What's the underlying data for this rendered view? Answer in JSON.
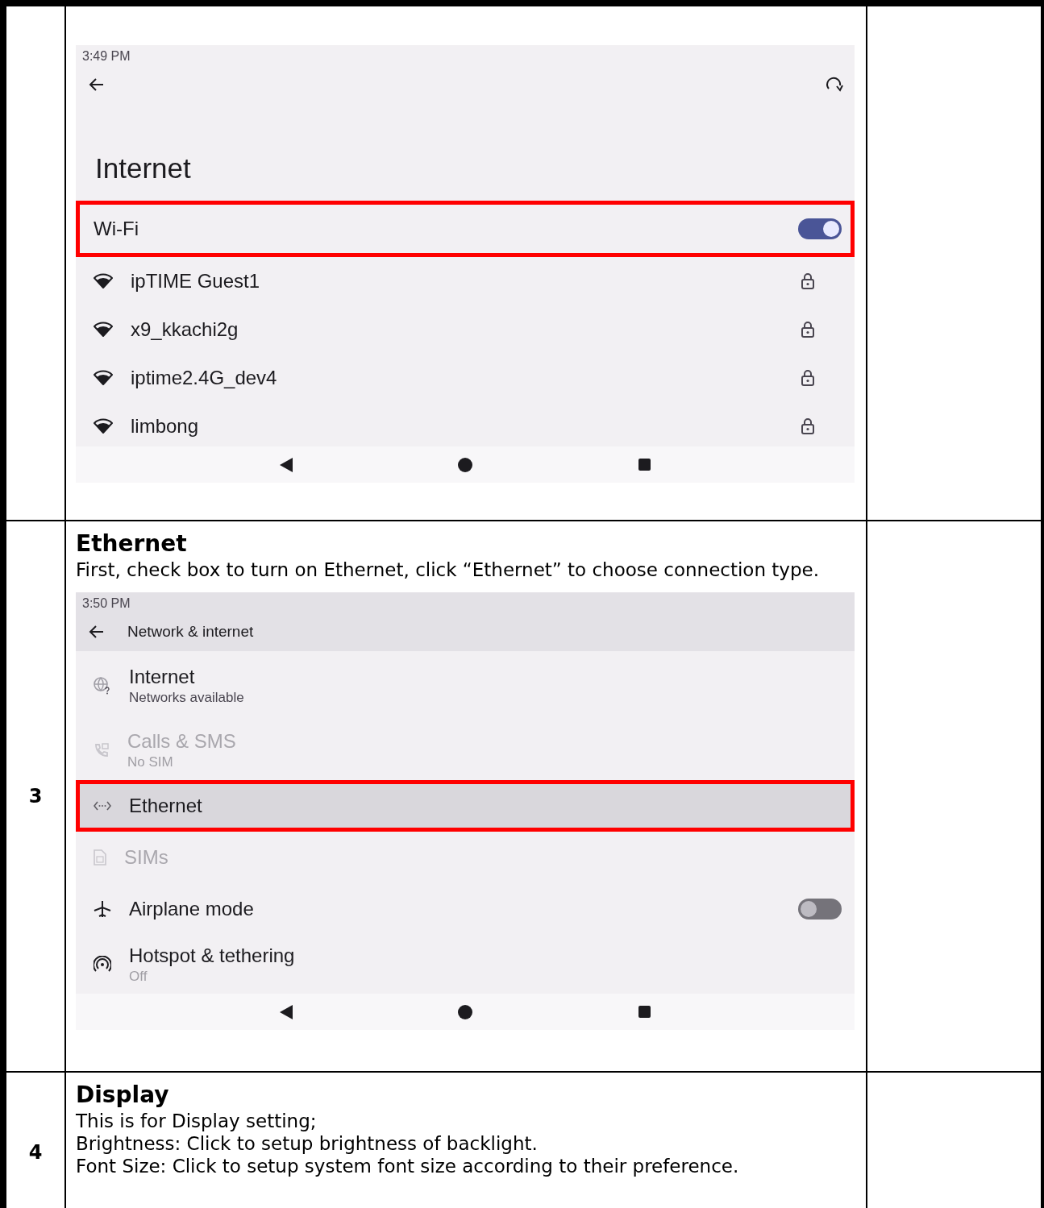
{
  "table": {
    "rows": [
      {
        "number": "",
        "screen": {
          "kind": "wifi",
          "time": "3:49 PM",
          "title": "Internet",
          "wifi": {
            "label": "Wi-Fi",
            "on": true,
            "highlighted": true
          },
          "networks": [
            {
              "name": "ipTIME Guest1",
              "locked": true
            },
            {
              "name": "x9_kkachi2g",
              "locked": true
            },
            {
              "name": "iptime2.4G_dev4",
              "locked": true
            },
            {
              "name": "limbong",
              "locked": true
            }
          ]
        }
      },
      {
        "number": "3",
        "heading": "Ethernet",
        "lines": [
          "First, check box to turn on Ethernet, click “Ethernet” to choose connection type."
        ],
        "screen": {
          "kind": "network",
          "time": "3:50 PM",
          "header": "Network & internet",
          "items": [
            {
              "title": "Internet",
              "subtitle": "Networks available",
              "disabled": false,
              "highlighted": false
            },
            {
              "title": "Calls & SMS",
              "subtitle": "No SIM",
              "disabled": true,
              "highlighted": false
            },
            {
              "title": "Ethernet",
              "disabled": false,
              "highlighted": true
            },
            {
              "title": "SIMs",
              "disabled": true,
              "highlighted": false
            },
            {
              "title": "Airplane mode",
              "disabled": false,
              "highlighted": false,
              "on": false
            },
            {
              "title": "Hotspot & tethering",
              "subtitle": "Off",
              "disabled": false,
              "highlighted": false
            }
          ]
        }
      },
      {
        "number": "4",
        "heading": "Display",
        "lines": [
          "This is for Display setting;",
          "Brightness: Click to setup brightness of backlight.",
          "Font Size: Click to setup system font size according to their preference."
        ]
      }
    ]
  }
}
